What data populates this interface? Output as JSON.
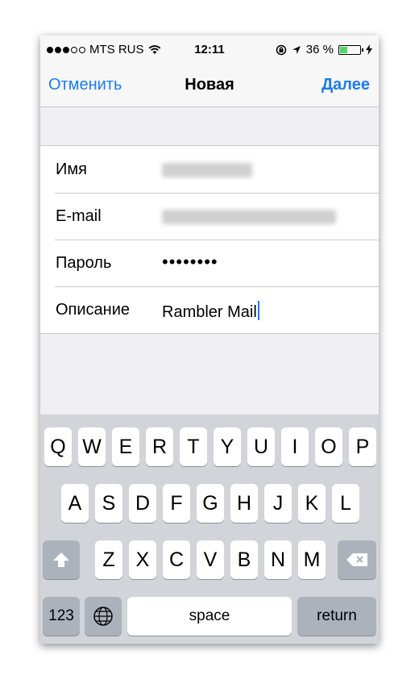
{
  "status_bar": {
    "carrier": "MTS RUS",
    "time": "12:11",
    "battery": "36 %",
    "battery_level": 0.36
  },
  "nav": {
    "cancel_label": "Отменить",
    "title": "Новая",
    "next_label": "Далее"
  },
  "form": {
    "name_label": "Имя",
    "email_label": "E-mail",
    "password_label": "Пароль",
    "password_mask": "••••••••",
    "description_label": "Описание",
    "description_value": "Rambler Mail"
  },
  "keyboard": {
    "row1": [
      "Q",
      "W",
      "E",
      "R",
      "T",
      "Y",
      "U",
      "I",
      "O",
      "P"
    ],
    "row2": [
      "A",
      "S",
      "D",
      "F",
      "G",
      "H",
      "J",
      "K",
      "L"
    ],
    "row3": [
      "Z",
      "X",
      "C",
      "V",
      "B",
      "N",
      "M"
    ],
    "numbers_label": "123",
    "space_label": "space",
    "return_label": "return"
  }
}
